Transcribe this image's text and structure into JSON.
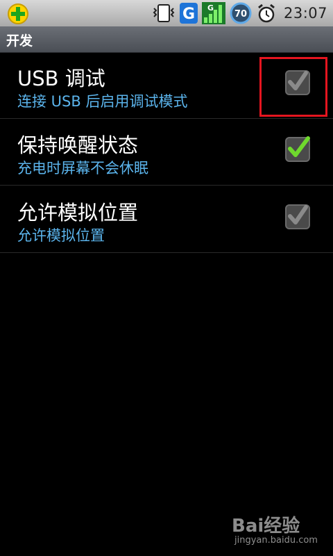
{
  "status_bar": {
    "left_icon": "plus-shield-app-icon",
    "icons": [
      "sim-card-icon",
      "g-app-icon",
      "signal-icon",
      "battery-icon",
      "alarm-clock-icon"
    ],
    "network_label": "G",
    "signal_label": "G",
    "battery_level": "70",
    "time": "23:07"
  },
  "title": "开发",
  "settings": [
    {
      "label": "USB 调试",
      "summary": "连接 USB 后启用调试模式",
      "checked": true,
      "enabled": false,
      "highlighted": true
    },
    {
      "label": "保持唤醒状态",
      "summary": "充电时屏幕不会休眠",
      "checked": true,
      "enabled": true
    },
    {
      "label": "允许模拟位置",
      "summary": "允许模拟位置",
      "checked": true,
      "enabled": false
    }
  ],
  "colors": {
    "summary_text": "#5bb4ec",
    "check_active": "#6fd82d",
    "check_disabled": "#8a8a8a",
    "highlight_border": "#e5151f"
  },
  "watermark": {
    "logo": "Bai经验",
    "url": "jingyan.baidu.com"
  }
}
